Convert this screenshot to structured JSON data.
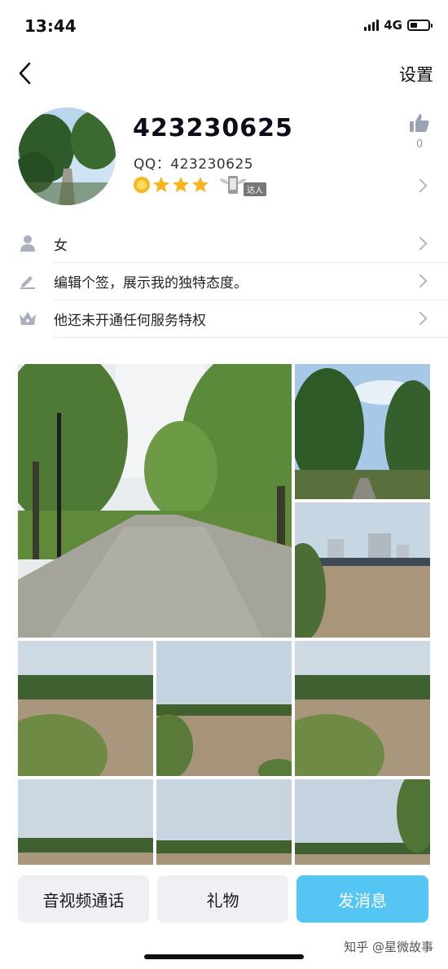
{
  "status_bar": {
    "time": "13:44",
    "network": "4G"
  },
  "nav": {
    "settings_label": "设置"
  },
  "profile": {
    "name": "423230625",
    "qq_line": "QQ：423230625",
    "badge_label": "达人",
    "like_count": "0"
  },
  "info_rows": [
    {
      "icon": "person-icon",
      "label": "女"
    },
    {
      "icon": "pencil-icon",
      "label": "编辑个签，展示我的独特态度。"
    },
    {
      "icon": "crown-icon",
      "label": "他还未开通任何服务特权"
    }
  ],
  "actions": {
    "call_label": "音视频通话",
    "gift_label": "礼物",
    "message_label": "发消息"
  },
  "watermark": "知乎 @星微故事",
  "colors": {
    "accent": "#55c6f4",
    "button_gray": "#eef0f5"
  }
}
